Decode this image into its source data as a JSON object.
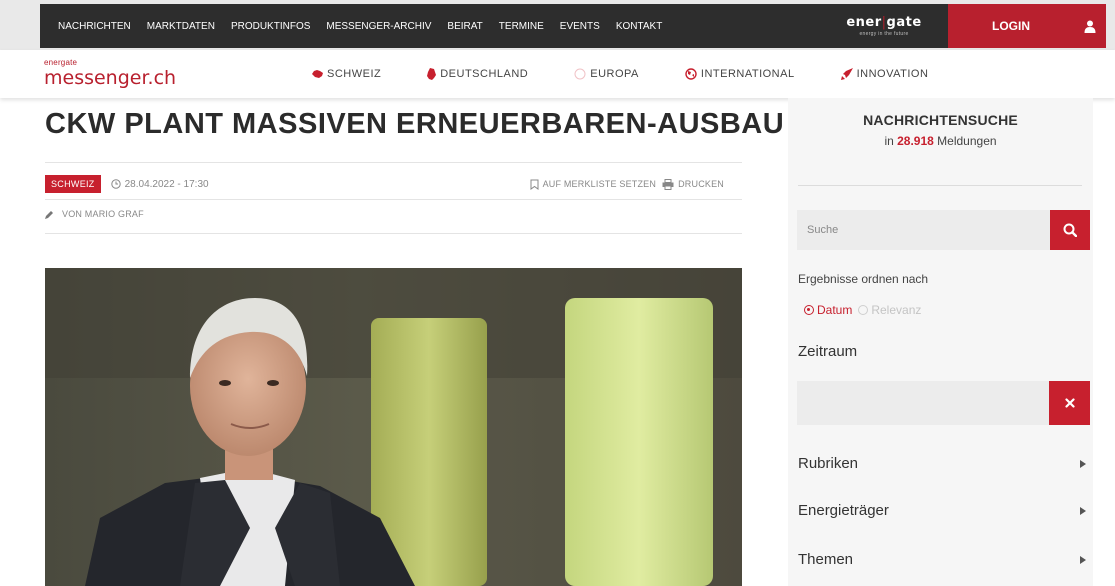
{
  "topnav": {
    "items": [
      "NACHRICHTEN",
      "MARKTDATEN",
      "PRODUKTINFOS",
      "MESSENGER-ARCHIV",
      "BEIRAT",
      "TERMINE",
      "EVENTS",
      "KONTAKT"
    ],
    "brand_left": "ener",
    "brand_sep": "|",
    "brand_right": "gate",
    "brand_sub": "energy in the future",
    "login_label": "LOGIN",
    "user_icon": "user-icon"
  },
  "subnav": {
    "logo_small": "energate",
    "logo_big": "messenger.ch",
    "regions": [
      {
        "label": "SCHWEIZ",
        "icon": "swiss-map-icon"
      },
      {
        "label": "DEUTSCHLAND",
        "icon": "germany-map-icon"
      },
      {
        "label": "EUROPA",
        "icon": "europe-circle-icon"
      },
      {
        "label": "INTERNATIONAL",
        "icon": "globe-icon"
      },
      {
        "label": "INNOVATION",
        "icon": "rocket-icon"
      }
    ]
  },
  "article": {
    "headline": "CKW PLANT MASSIVEN ERNEUERBAREN-AUSBAU",
    "category": "SCHWEIZ",
    "date": "28.04.2022 - 17:30",
    "bookmark_label": "AUF MERKLISTE SETZEN",
    "print_label": "DRUCKEN",
    "author": "VON MARIO GRAF"
  },
  "sidebar": {
    "title": "NACHRICHTENSUCHE",
    "sub_prefix": "in",
    "count": "28.918",
    "sub_suffix": "Meldungen",
    "search_placeholder": "Suche",
    "order_label": "Ergebnisse ordnen nach",
    "order_options": [
      "Datum",
      "Relevanz"
    ],
    "zeitraum_label": "Zeitraum",
    "accordions": [
      "Rubriken",
      "Energieträger",
      "Themen"
    ]
  },
  "colors": {
    "accent": "#c7202e",
    "topbar": "#2d2d2d",
    "sidebar_bg": "#f6f6f6"
  }
}
